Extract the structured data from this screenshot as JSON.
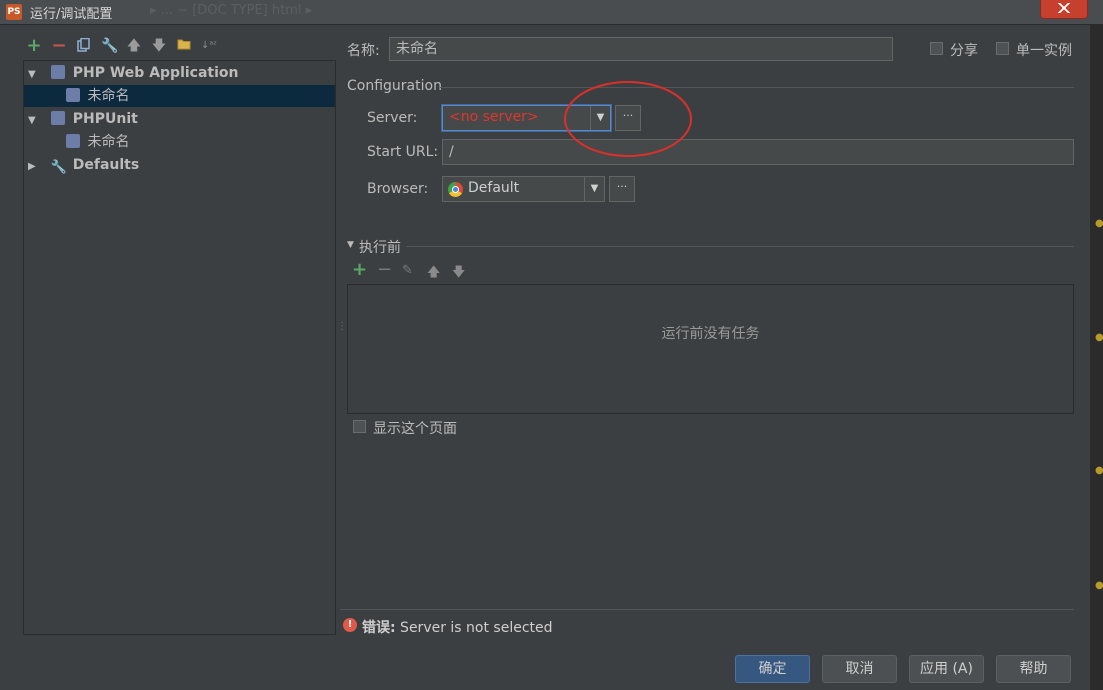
{
  "window": {
    "title": "运行/调试配置",
    "ghost_title": "▸  ... ~ [DOC TYPE] html ▸"
  },
  "left_toolbar": {
    "icons": [
      "add-icon",
      "remove-icon",
      "copy-icon",
      "wrench-icon",
      "move-up-icon",
      "move-down-icon",
      "folder-icon",
      "sort-icon"
    ]
  },
  "tree": {
    "items": [
      {
        "label": "PHP Web Application",
        "level": 0,
        "expanded": true,
        "bold": true
      },
      {
        "label": "未命名",
        "level": 1,
        "selected": true
      },
      {
        "label": "PHPUnit",
        "level": 0,
        "expanded": true,
        "bold": true
      },
      {
        "label": "未命名",
        "level": 1
      },
      {
        "label": "Defaults",
        "level": 0,
        "expanded": false,
        "bold": true
      }
    ]
  },
  "name_row": {
    "label": "名称:",
    "value": "未命名",
    "share_label": "分享",
    "single_instance_label": "单一实例"
  },
  "configuration": {
    "section_title": "Configuration",
    "server_label": "Server:",
    "server_value": "<no server>",
    "start_url_label": "Start URL:",
    "start_url_value": "/",
    "browser_label": "Browser:",
    "browser_value": "Default"
  },
  "before_launch": {
    "section_title": "执行前",
    "empty_text": "运行前没有任务",
    "show_page_label": "显示这个页面"
  },
  "error": {
    "prefix": "错误:",
    "message": " Server is not selected"
  },
  "buttons": {
    "ok": "确定",
    "cancel": "取消",
    "apply": "应用 (A)",
    "help": "帮助"
  },
  "colors": {
    "accent": "#365880",
    "error_text": "#e0362c",
    "annotation_circle": "#d9302a",
    "add_green": "#59a869",
    "remove_red": "#c75450"
  }
}
